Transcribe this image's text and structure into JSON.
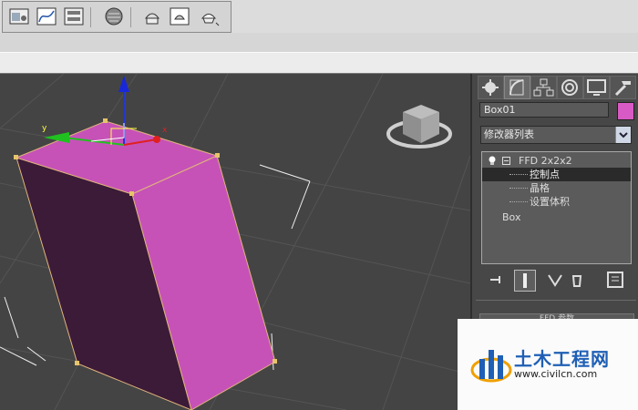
{
  "toolbar": {
    "buttons": [
      {
        "name": "scene-explorer-icon"
      },
      {
        "name": "curve-editor-icon"
      },
      {
        "name": "schematic-view-icon"
      },
      {
        "name": "material-editor-icon"
      },
      {
        "name": "render-setup-icon"
      },
      {
        "name": "rendered-frame-icon"
      },
      {
        "name": "render-production-icon"
      }
    ]
  },
  "viewport": {
    "gizmo_axis_x": "x",
    "gizmo_axis_y": "y",
    "object_color": "#c652b8"
  },
  "command_panel": {
    "tabs": [
      "create-icon",
      "modify-icon",
      "hierarchy-icon",
      "motion-icon",
      "display-icon",
      "utilities-icon"
    ],
    "object_name": "Box01",
    "object_color": "#d85ac4",
    "modifier_list": "修改器列表",
    "stack": {
      "modifier": "FFD 2x2x2",
      "sub_control_points": "控制点",
      "sub_lattice": "晶格",
      "sub_set_volume": "设置体积",
      "base": "Box"
    },
    "rollout_title": "FFD 参数"
  },
  "watermark": {
    "title": "土木工程网",
    "url": "www.civilcn.com"
  }
}
